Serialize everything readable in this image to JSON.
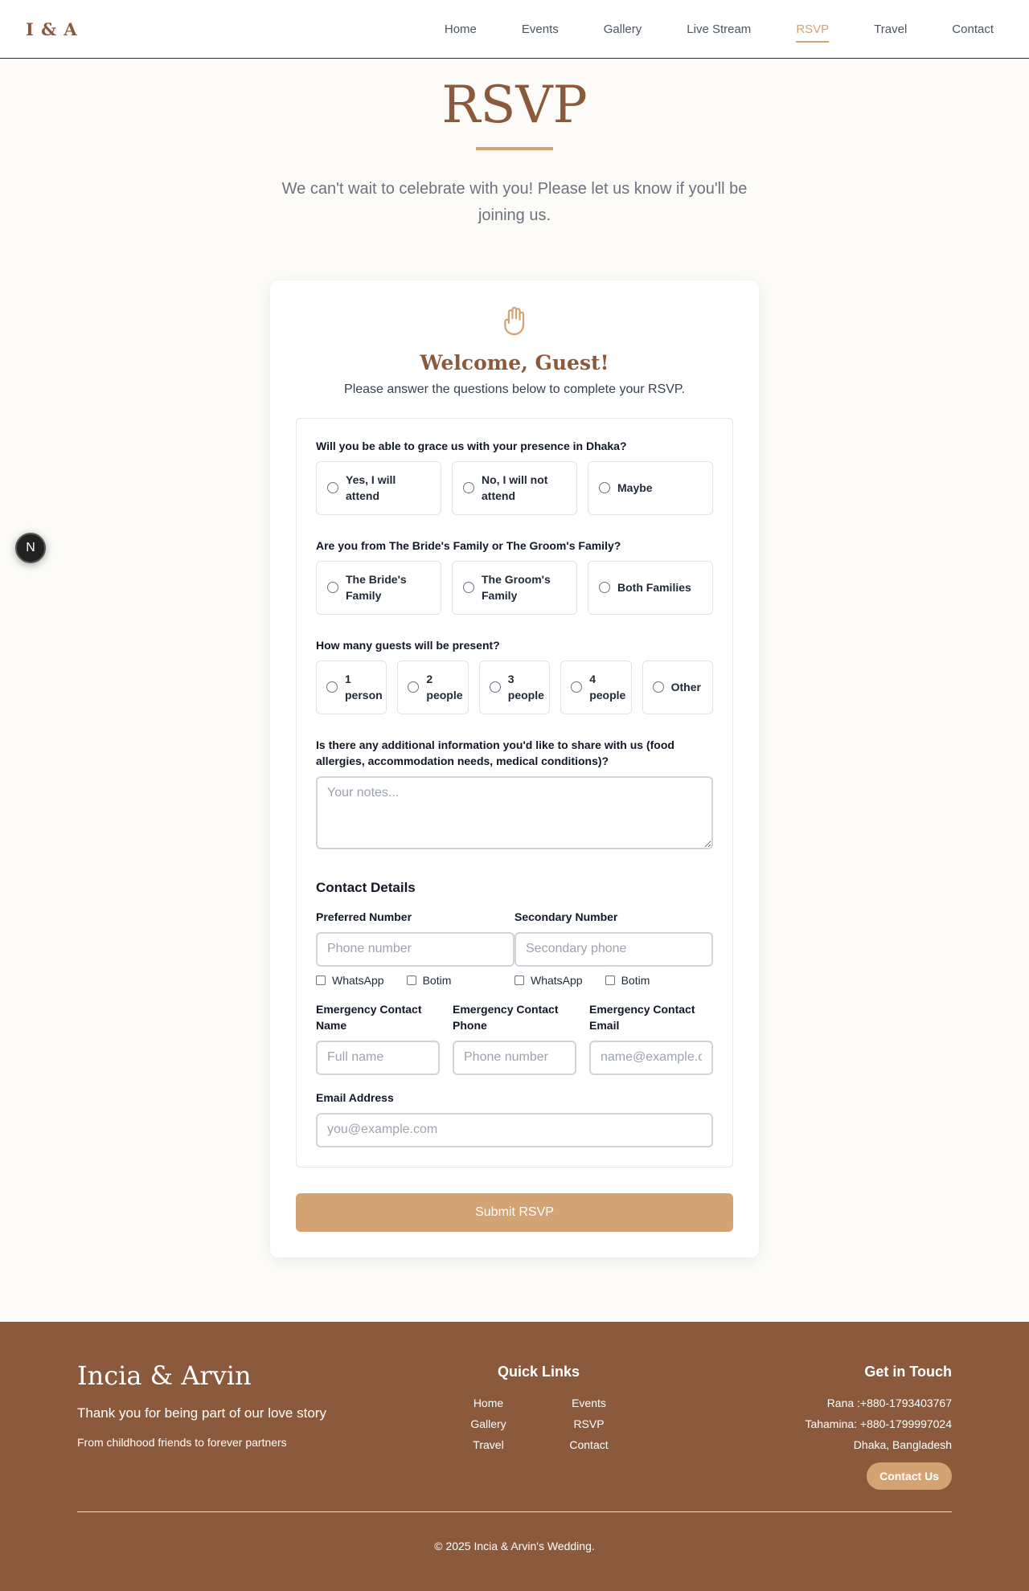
{
  "header": {
    "logo": "I & A",
    "nav": [
      "Home",
      "Events",
      "Gallery",
      "Live Stream",
      "RSVP",
      "Travel",
      "Contact"
    ]
  },
  "hero": {
    "title": "RSVP",
    "intro": "We can't wait to celebrate with you! Please let us know if you'll be joining us."
  },
  "card": {
    "welcome": "Welcome, Guest!",
    "subtitle": "Please answer the questions below to complete your RSVP.",
    "q1": {
      "label": "Will you be able to grace us with your presence in Dhaka?",
      "options": [
        "Yes, I will attend",
        "No, I will not attend",
        "Maybe"
      ]
    },
    "q2": {
      "label": "Are you from The Bride's Family or The Groom's Family?",
      "options": [
        "The Bride's Family",
        "The Groom's Family",
        "Both Families"
      ]
    },
    "q3": {
      "label": "How many guests will be present?",
      "options": [
        "1 person",
        "2 people",
        "3 people",
        "4 people",
        "Other"
      ]
    },
    "q4": {
      "label": "Is there any additional information you'd like to share with us (food allergies, accommodation needs, medical conditions)?",
      "placeholder": "Your notes..."
    },
    "contact": {
      "title": "Contact Details",
      "preferred_label": "Preferred Number",
      "preferred_placeholder": "Phone number",
      "secondary_label": "Secondary Number",
      "secondary_placeholder": "Secondary phone",
      "whatsapp": "WhatsApp",
      "botim": "Botim",
      "emergency_name_label": "Emergency Contact Name",
      "emergency_name_placeholder": "Full name",
      "emergency_phone_label": "Emergency Contact Phone",
      "emergency_phone_placeholder": "Phone number",
      "emergency_email_label": "Emergency Contact Email",
      "emergency_email_placeholder": "name@example.com",
      "email_label": "Email Address",
      "email_placeholder": "you@example.com"
    },
    "submit": "Submit RSVP"
  },
  "badge": "N",
  "footer": {
    "brand": "Incia & Arvin",
    "tagline": "Thank you for being part of our love story",
    "subtag": "From childhood friends to forever partners",
    "quick_links_title": "Quick Links",
    "links": [
      "Home",
      "Events",
      "Gallery",
      "RSVP",
      "Travel",
      "Contact"
    ],
    "touch_title": "Get in Touch",
    "contact1": "Rana :+880-1793403767",
    "contact2": "Tahamina: +880-1799997024",
    "location": "Dhaka, Bangladesh",
    "contact_button": "Contact Us",
    "copyright": "© 2025 Incia & Arvin's Wedding."
  },
  "colors": {
    "accent": "#d4a373",
    "brand_brown": "#8b5a3c",
    "page_bg": "#fcfbf7"
  }
}
